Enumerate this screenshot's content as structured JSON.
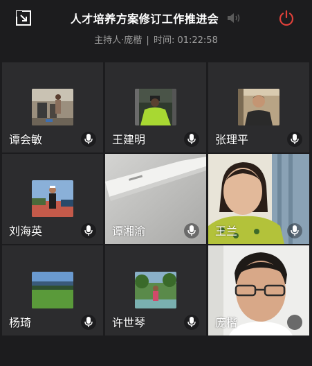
{
  "meeting": {
    "title": "人才培养方案修订工作推进会",
    "host_label": "主持人·庞楷",
    "separator": "|",
    "time_label": "时间: 01:22:58"
  },
  "colors": {
    "background": "#1c1c1e",
    "tile": "#2c2c2e",
    "power": "#e0413a",
    "subtitle": "#a0a0a0"
  },
  "participants": [
    {
      "name": "谭会敏",
      "view": "avatar",
      "mic": "mic-icon"
    },
    {
      "name": "王建明",
      "view": "avatar",
      "mic": "mic-icon"
    },
    {
      "name": "张理平",
      "view": "avatar",
      "mic": "mic-icon"
    },
    {
      "name": "刘海英",
      "view": "avatar",
      "mic": "mic-icon"
    },
    {
      "name": "谭湘渝",
      "view": "video",
      "mic": "mic-icon"
    },
    {
      "name": "王兰",
      "view": "video",
      "mic": "mic-icon"
    },
    {
      "name": "杨琦",
      "view": "avatar",
      "mic": "mic-icon"
    },
    {
      "name": "许世琴",
      "view": "avatar",
      "mic": "mic-icon"
    },
    {
      "name": "庞楷",
      "view": "video",
      "mic": "speaking-indicator"
    }
  ]
}
